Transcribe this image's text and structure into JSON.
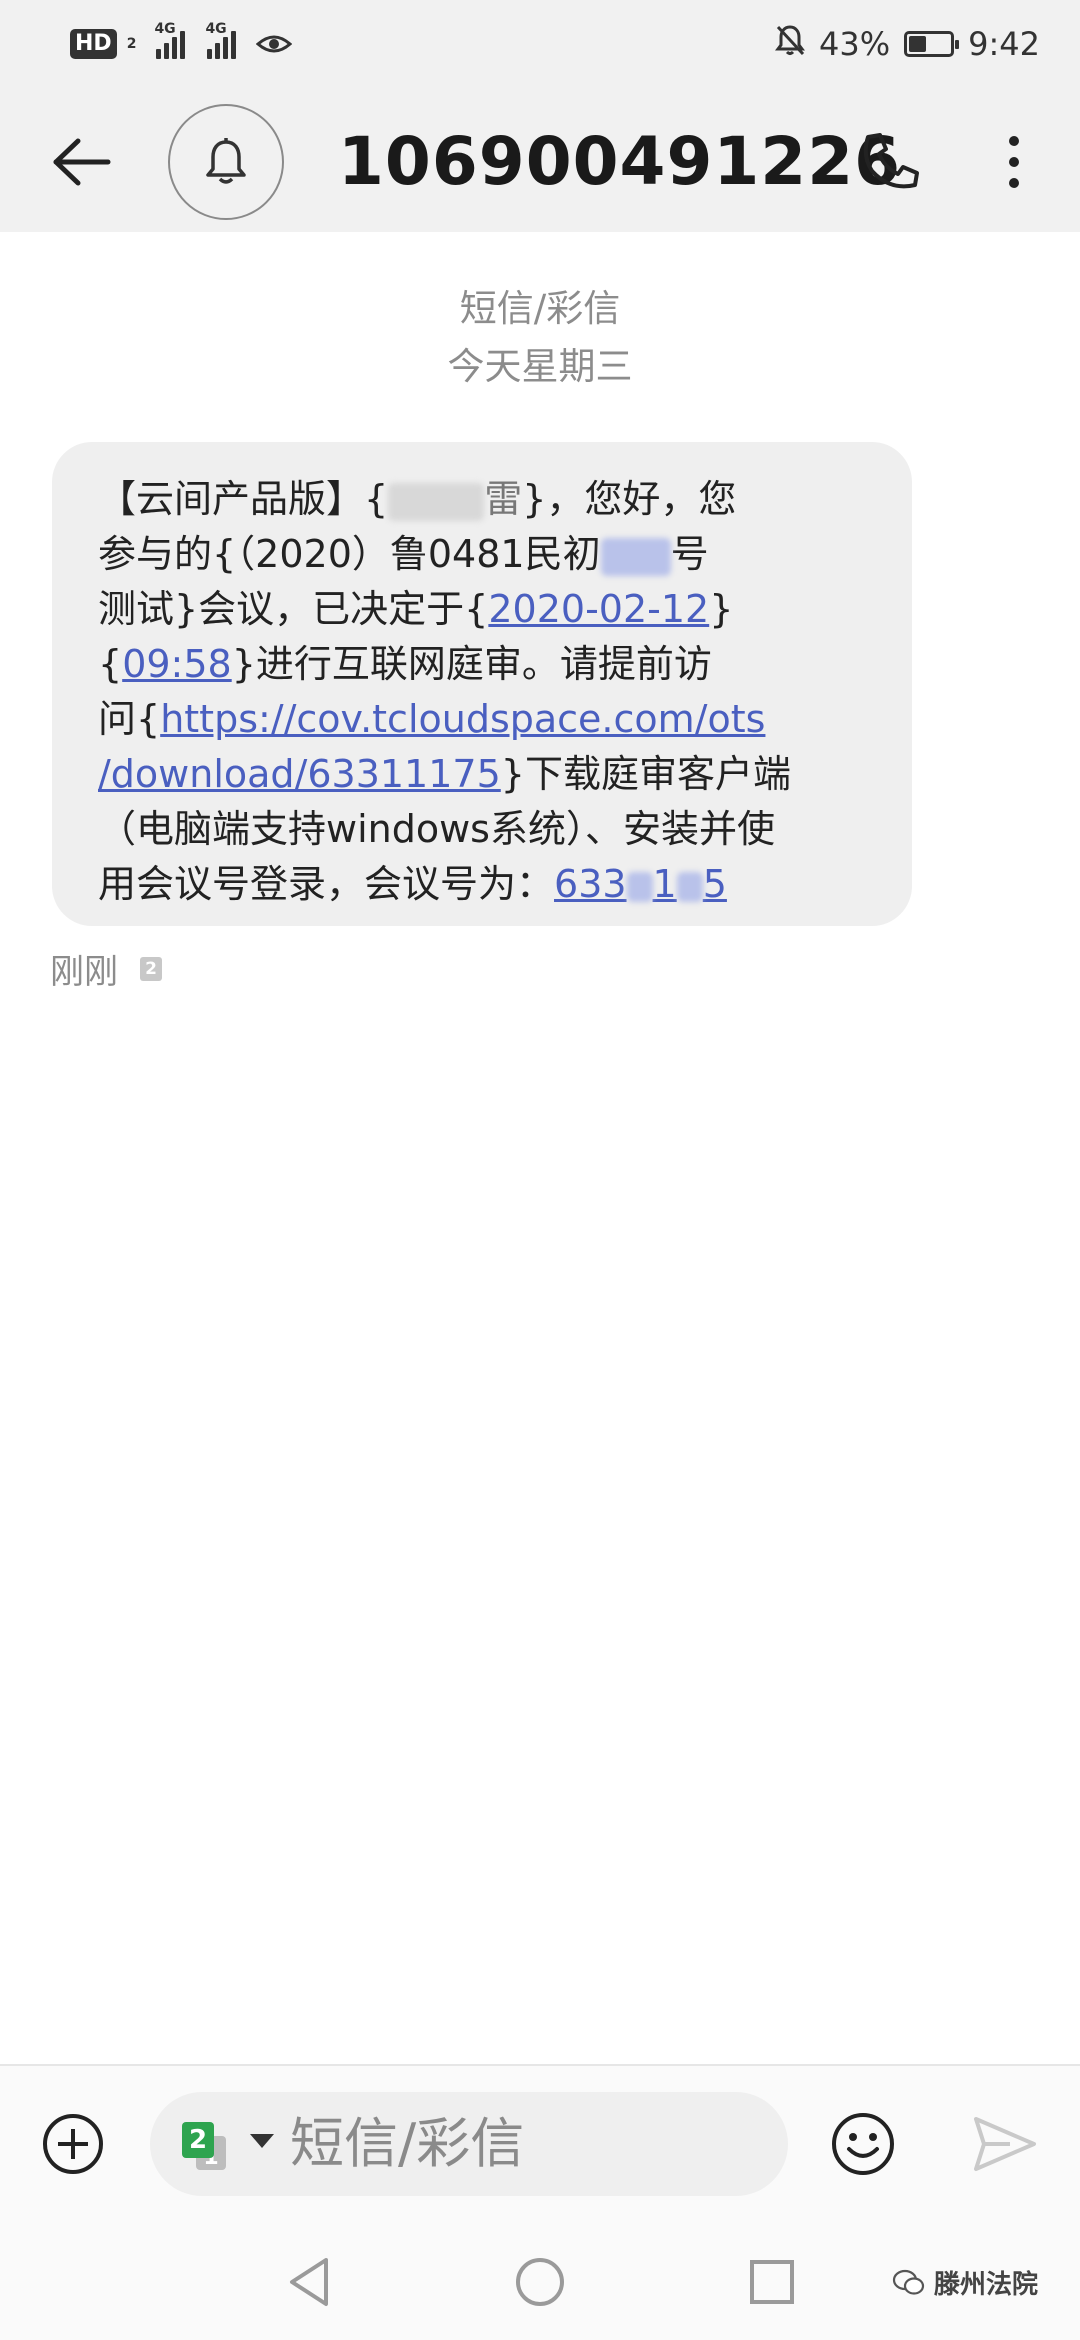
{
  "status_bar": {
    "hd": "HD",
    "hd_sim": "2",
    "net1": "4G",
    "net2": "4G",
    "battery_percent": "43%",
    "battery_level": 0.43,
    "time": "9:42"
  },
  "header": {
    "title": "106900491226",
    "icons": [
      "back-arrow-icon",
      "bell-icon",
      "phone-icon",
      "more-vert-icon"
    ]
  },
  "conversation": {
    "channel": "短信/彩信",
    "date_label": "今天星期三"
  },
  "message": {
    "l1_a": "【云间产品版】{",
    "l1_b": "}，您好，您",
    "l1_name_tail": "雷",
    "l2_a": "参与的{（2020）鲁0481民初",
    "l2_b": "号",
    "l3_a": "测试}会议，已决定于{",
    "l3_date": "2020-02-12",
    "l3_c": "}",
    "l4_a": "{",
    "l4_time": "09:58",
    "l4_b": "}进行互联网庭审。请提前访",
    "l5_a": "问{",
    "l5_url1": "https://cov.tcloudspace.com/ots",
    "l6_url2": "/download/63311175",
    "l6_b": "}下载庭审客户端",
    "l7": "（电脑端支持windows系统）、安装并使",
    "l8_a": "用会议号登录，会议号为：",
    "l8_id1": "633",
    "l8_id2": "1",
    "l8_id3": "5",
    "timestamp": "刚刚",
    "sim_badge": "2"
  },
  "composer": {
    "sim_front": "2",
    "sim_back": "1",
    "placeholder": "短信/彩信"
  },
  "watermark": {
    "text": "滕州法院"
  }
}
